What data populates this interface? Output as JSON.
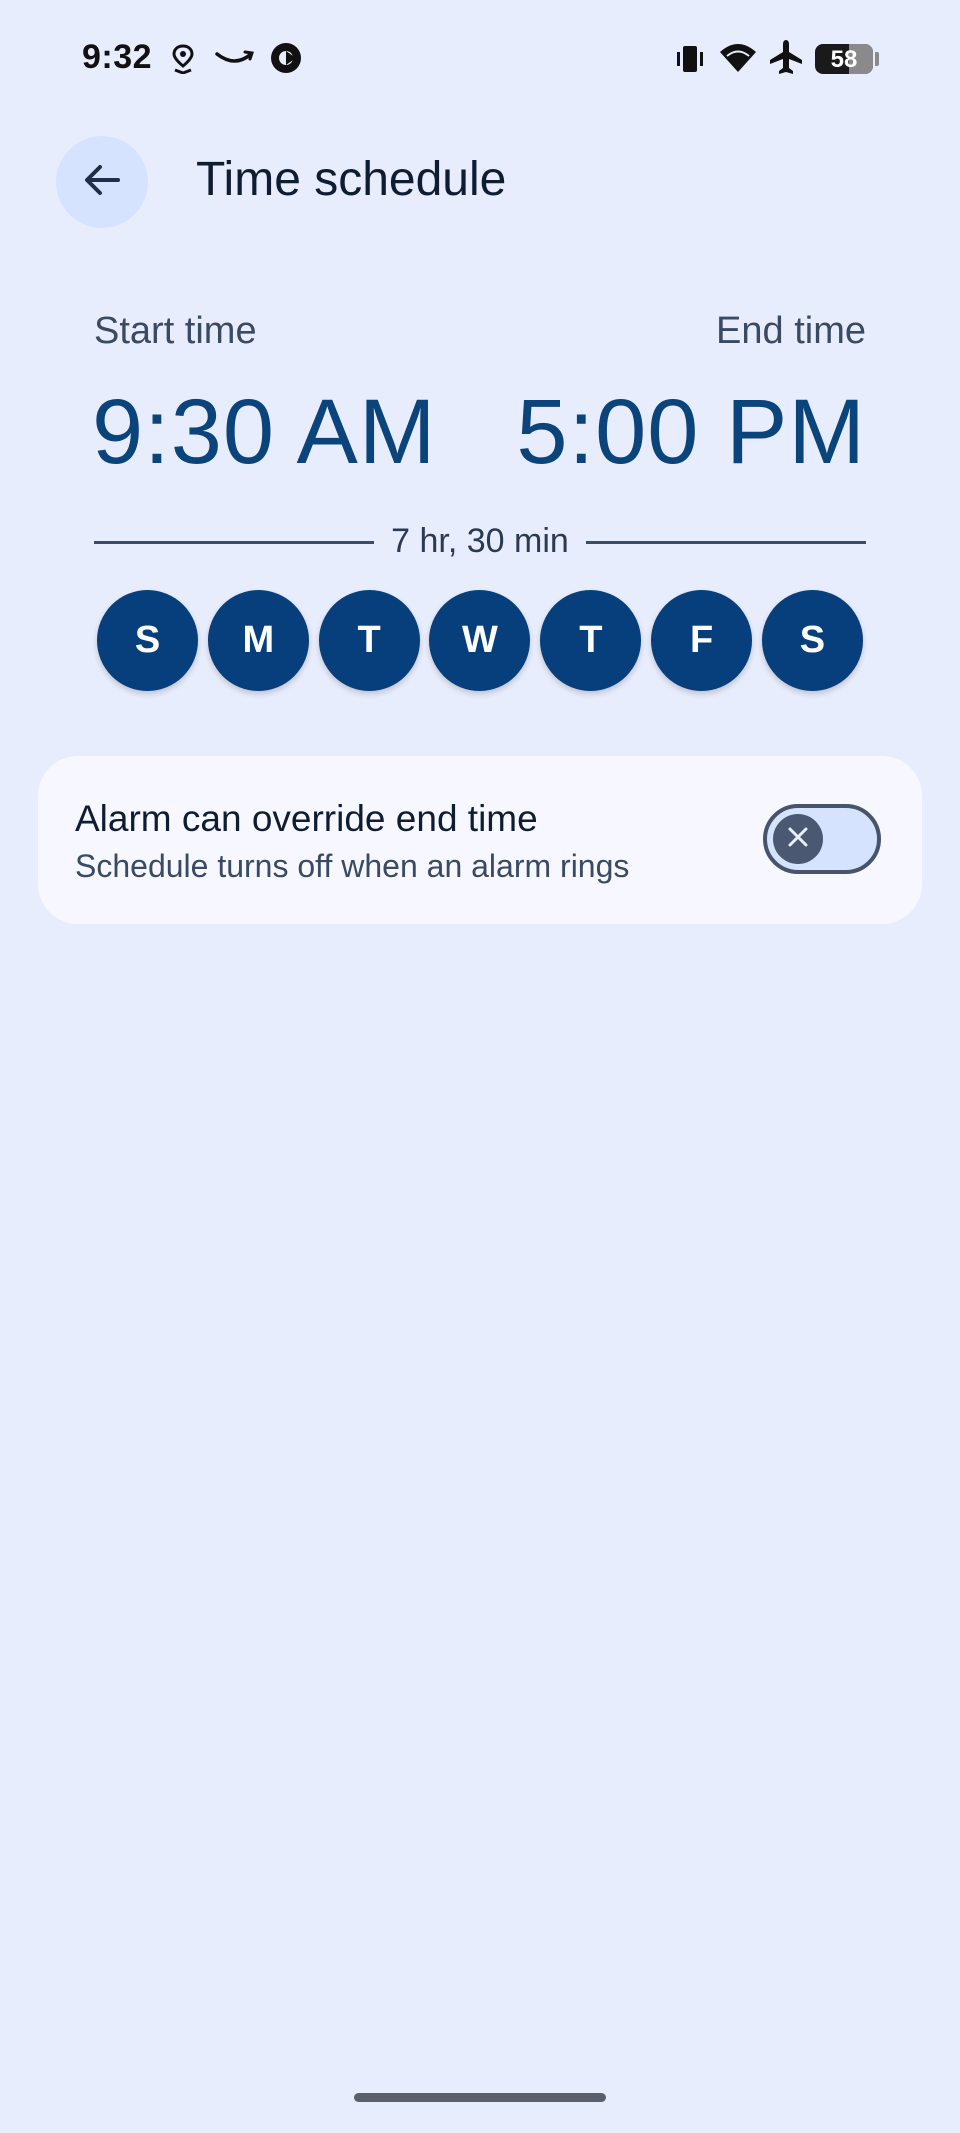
{
  "status_bar": {
    "time": "9:32",
    "battery_level": "58",
    "left_icons": [
      "location-pin-icon",
      "amazon-smile-icon",
      "badge-gear-icon"
    ],
    "right_icons": [
      "vibrate-icon",
      "wifi-icon",
      "airplane-mode-icon",
      "battery-icon"
    ]
  },
  "header": {
    "title": "Time schedule",
    "back_icon": "arrow-back-icon"
  },
  "schedule": {
    "start_label": "Start time",
    "end_label": "End time",
    "start_time": "9:30 AM",
    "end_time": "5:00 PM",
    "duration": "7 hr, 30 min",
    "days": [
      {
        "label": "S",
        "selected": true
      },
      {
        "label": "M",
        "selected": true
      },
      {
        "label": "T",
        "selected": true
      },
      {
        "label": "W",
        "selected": true
      },
      {
        "label": "T",
        "selected": true
      },
      {
        "label": "F",
        "selected": true
      },
      {
        "label": "S",
        "selected": true
      }
    ]
  },
  "alarm_override": {
    "title": "Alarm can override end time",
    "subtitle": "Schedule turns off when an alarm rings",
    "enabled": false,
    "toggle_icon": "close-icon"
  },
  "colors": {
    "background": "#e8edfd",
    "accent": "#063f7c",
    "card": "#f7f8ff",
    "back_button": "#d6e3ff"
  }
}
